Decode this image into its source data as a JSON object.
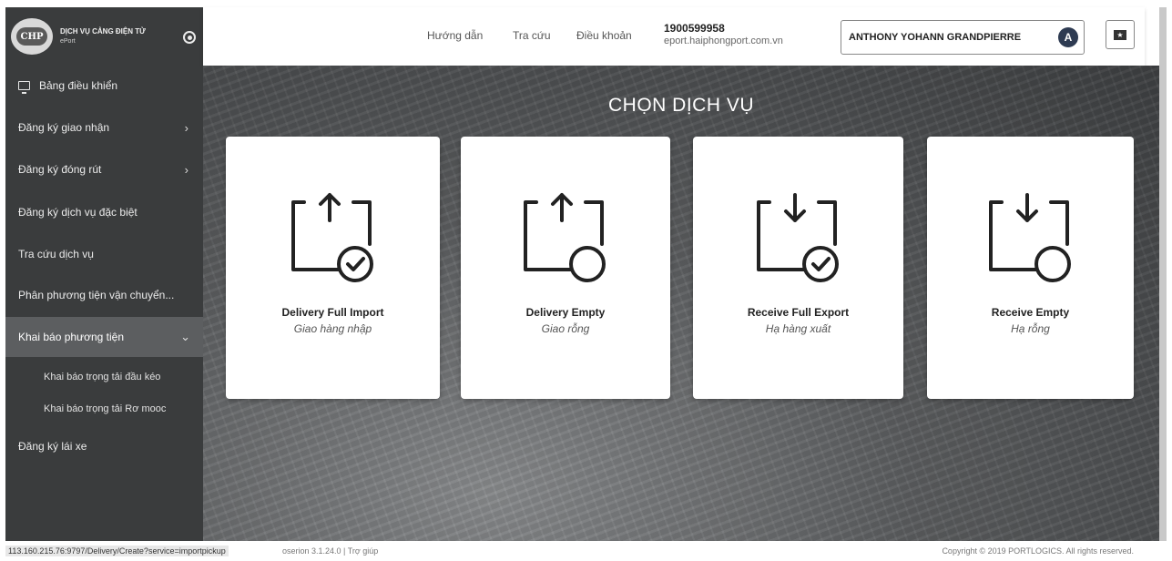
{
  "brand": {
    "logo_text": "CHP",
    "title": "DỊCH VỤ CẢNG ĐIỆN TỬ",
    "subtitle": "ePort"
  },
  "sidebar": {
    "items": [
      {
        "label": "Bảng điều khiển",
        "icon": "monitor-icon"
      },
      {
        "label": "Đăng ký giao nhận",
        "chevron": "›"
      },
      {
        "label": "Đăng ký đóng rút",
        "chevron": "›"
      },
      {
        "label": "Đăng ký dịch vụ đặc biệt"
      },
      {
        "label": "Tra cứu dịch vụ"
      },
      {
        "label": "Phân phương tiện vận chuyển..."
      },
      {
        "label": "Khai báo phương tiện",
        "chevron": "⌄",
        "active": true
      },
      {
        "label": "Đăng ký lái xe"
      }
    ],
    "sub_items": [
      {
        "label": "Khai báo trọng tải đầu kéo"
      },
      {
        "label": "Khai báo trọng tải Rơ mooc"
      }
    ]
  },
  "header": {
    "nav": [
      "Hướng dẫn",
      "Tra cứu",
      "Điều khoản"
    ],
    "phone": "1900599958",
    "website": "eport.haiphongport.com.vn",
    "user_name": "ANTHONY YOHANN GRANDPIERRE",
    "user_initial": "A",
    "flag_glyph": "★"
  },
  "main": {
    "title": "CHỌN DỊCH VỤ",
    "cards": [
      {
        "title": "Delivery Full Import",
        "subtitle": "Giao hàng nhập",
        "icon": "box-upload-check-icon"
      },
      {
        "title": "Delivery Empty",
        "subtitle": "Giao rỗng",
        "icon": "box-upload-empty-icon"
      },
      {
        "title": "Receive Full Export",
        "subtitle": "Hạ hàng xuất",
        "icon": "box-download-check-icon"
      },
      {
        "title": "Receive Empty",
        "subtitle": "Hạ rỗng",
        "icon": "box-download-empty-icon"
      }
    ]
  },
  "footer": {
    "status_url": "113.160.215.76:9797/Delivery/Create?service=importpickup",
    "version": "oserion 3.1.24.0 | Trợ giúp",
    "copyright": "Copyright © 2019 PORTLOGICS. All rights reserved."
  },
  "colors": {
    "sidebar_bg": "#3a3c3d",
    "active_item_bg": "#5c5e60",
    "avatar_bg": "#2e3b52",
    "card_bg": "#ffffff"
  }
}
